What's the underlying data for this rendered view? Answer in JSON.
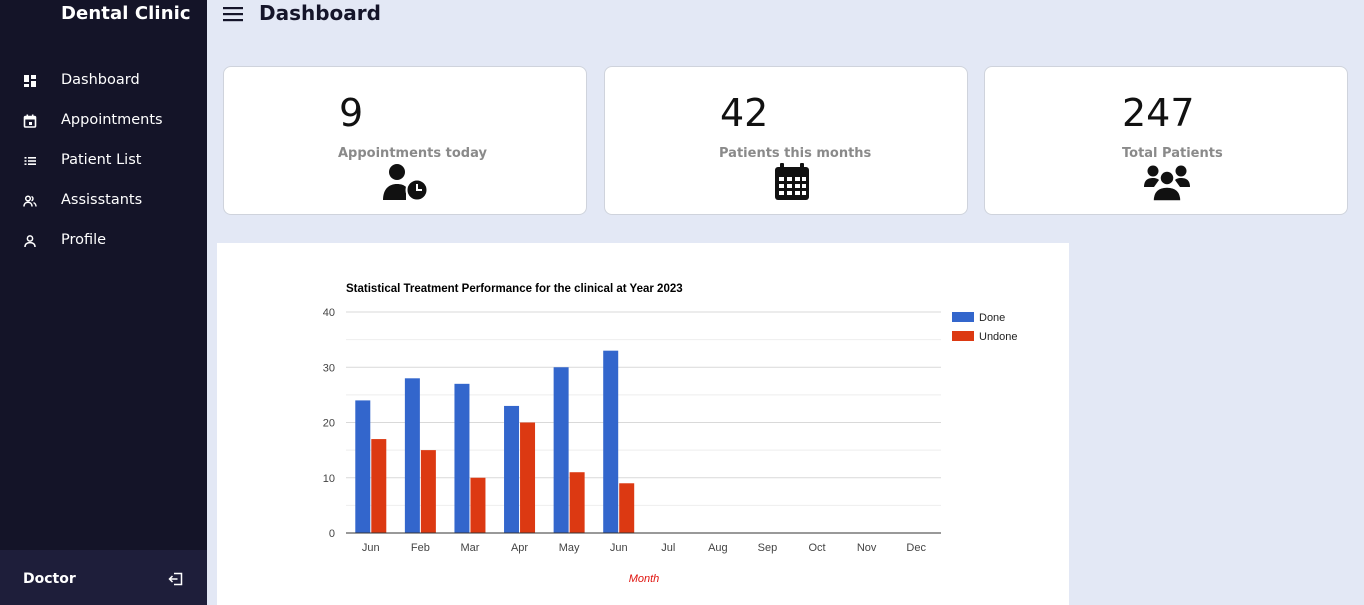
{
  "sidebar": {
    "brand": "Dental Clinic",
    "items": [
      {
        "label": "Dashboard",
        "icon": "dashboard-icon"
      },
      {
        "label": "Appointments",
        "icon": "calendar-icon"
      },
      {
        "label": "Patient List",
        "icon": "list-icon"
      },
      {
        "label": "Assisstants",
        "icon": "people-icon"
      },
      {
        "label": "Profile",
        "icon": "person-icon"
      }
    ],
    "footer_user": "Doctor",
    "logout_icon": "logout-icon"
  },
  "header": {
    "title": "Dashboard",
    "menu_icon": "hamburger-menu-icon"
  },
  "cards": [
    {
      "value": "9",
      "caption": "Appointments today",
      "icon": "user-clock-icon"
    },
    {
      "value": "42",
      "caption": "Patients this months",
      "icon": "calendar-grid-icon"
    },
    {
      "value": "247",
      "caption": "Total Patients",
      "icon": "users-group-icon"
    }
  ],
  "colors": {
    "sidebar_bg": "#141428",
    "page_bg": "#e3e8f5",
    "done": "#3366cc",
    "undone": "#dc3912",
    "xlabel": "#e0140f"
  },
  "chart_data": {
    "type": "bar",
    "title": "Statistical Treatment Performance for the clinical at Year 2023",
    "xlabel": "Month",
    "ylabel": "",
    "ylim": [
      0,
      40
    ],
    "yticks": [
      "0",
      "10",
      "20",
      "30",
      "40"
    ],
    "grid": true,
    "legend_position": "right",
    "categories": [
      "Jun",
      "Feb",
      "Mar",
      "Apr",
      "May",
      "Jun",
      "Jul",
      "Aug",
      "Sep",
      "Oct",
      "Nov",
      "Dec"
    ],
    "series": [
      {
        "name": "Done",
        "values": [
          24,
          28,
          27,
          23,
          30,
          33,
          0,
          0,
          0,
          0,
          0,
          0
        ]
      },
      {
        "name": "Undone",
        "values": [
          17,
          15,
          10,
          20,
          11,
          9,
          0,
          0,
          0,
          0,
          0,
          0
        ]
      }
    ]
  }
}
